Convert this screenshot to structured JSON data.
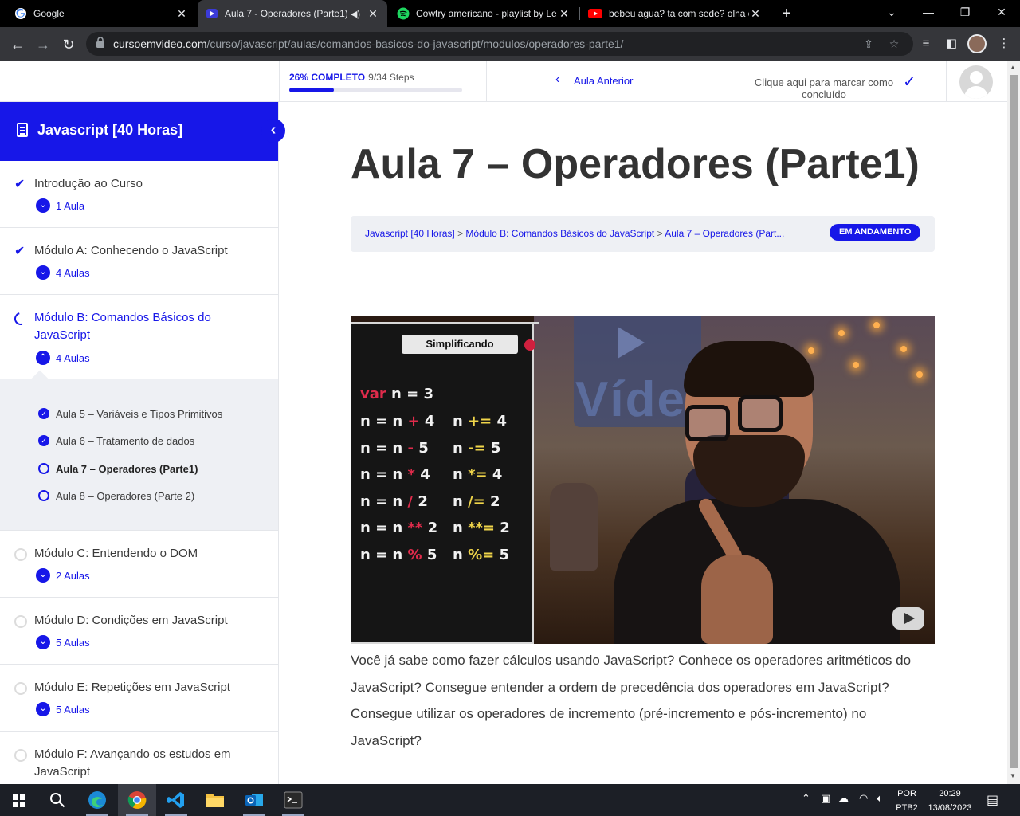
{
  "browser": {
    "tabs": [
      {
        "title": "Google",
        "active": false
      },
      {
        "title": "Aula 7 - Operadores (Parte1)",
        "active": true
      },
      {
        "title": "Cowtry americano - playlist by Le",
        "active": false
      },
      {
        "title": "bebeu agua? ta com sede? olha o",
        "active": false
      }
    ],
    "url_host": "cursoemvideo.com",
    "url_path": "/curso/javascript/aulas/comandos-basicos-do-javascript/modulos/operadores-parte1/"
  },
  "topbar": {
    "progress_label": "26% COMPLETO",
    "progress_steps": "9/34 Steps",
    "progress_fraction": 0.26,
    "prev_label": "Aula Anterior",
    "mark_complete_label": "Clique aqui para marcar como concluído"
  },
  "sidebar": {
    "course_title": "Javascript [40 Horas]",
    "modules": [
      {
        "title": "Introdução ao Curso",
        "count": "1 Aula",
        "status": "done"
      },
      {
        "title": "Módulo A: Conhecendo o JavaScript",
        "count": "4 Aulas",
        "status": "done"
      },
      {
        "title": "Módulo B: Comandos Básicos do JavaScript",
        "count": "4 Aulas",
        "status": "in-progress"
      },
      {
        "title": "Módulo C: Entendendo o DOM",
        "count": "2 Aulas",
        "status": "todo"
      },
      {
        "title": "Módulo D: Condições em JavaScript",
        "count": "5 Aulas",
        "status": "todo"
      },
      {
        "title": "Módulo E: Repetições em JavaScript",
        "count": "5 Aulas",
        "status": "todo"
      },
      {
        "title": "Módulo F: Avançando os estudos em JavaScript",
        "count": "",
        "status": "todo"
      }
    ],
    "lessons": [
      {
        "title": "Aula 5 – Variáveis e Tipos Primitivos",
        "status": "done"
      },
      {
        "title": "Aula 6 – Tratamento de dados",
        "status": "done"
      },
      {
        "title": "Aula 7 – Operadores (Parte1)",
        "status": "current"
      },
      {
        "title": "Aula 8 – Operadores (Parte 2)",
        "status": "todo"
      }
    ]
  },
  "main": {
    "title": "Aula 7 – Operadores (Parte1)",
    "breadcrumb": {
      "course": "Javascript [40 Horas]",
      "module": "Módulo B: Comandos Básicos do JavaScript",
      "lesson": "Aula 7 – Operadores (Part...",
      "separator": ">"
    },
    "status_badge": "EM ANDAMENTO",
    "video": {
      "panel_title": "Simplificando",
      "logo_text": "Vídeo",
      "code": {
        "decl": {
          "kw": "var",
          "rest": " n = 3"
        },
        "rows": [
          {
            "a": "n = n ",
            "op": "+",
            "b": " 4",
            "c": "n ",
            "op2": "+=",
            "d": " 4"
          },
          {
            "a": "n = n ",
            "op": "-",
            "b": " 5",
            "c": "n ",
            "op2": "-=",
            "d": " 5"
          },
          {
            "a": "n = n ",
            "op": "*",
            "b": " 4",
            "c": "n ",
            "op2": "*=",
            "d": " 4"
          },
          {
            "a": "n = n ",
            "op": "/",
            "b": " 2",
            "c": "n ",
            "op2": "/=",
            "d": " 2"
          },
          {
            "a": "n = n ",
            "op": "**",
            "b": " 2",
            "c": "n ",
            "op2": "**=",
            "d": " 2"
          },
          {
            "a": "n = n ",
            "op": "%",
            "b": " 5",
            "c": "n ",
            "op2": "%=",
            "d": " 5"
          }
        ]
      }
    },
    "description": "Você já sabe como fazer cálculos usando JavaScript? Conhece os operadores aritméticos do JavaScript? Consegue entender a ordem de precedência dos operadores em JavaScript? Consegue utilizar os operadores de incremento (pré-incremento e pós-incremento) no JavaScript?"
  },
  "taskbar": {
    "lang_top": "POR",
    "lang_bottom": "PTB2",
    "time": "20:29",
    "date": "13/08/2023"
  },
  "colors": {
    "accent": "#1717e8",
    "chrome_dark": "#35363a",
    "taskbar": "#1c1f26"
  }
}
